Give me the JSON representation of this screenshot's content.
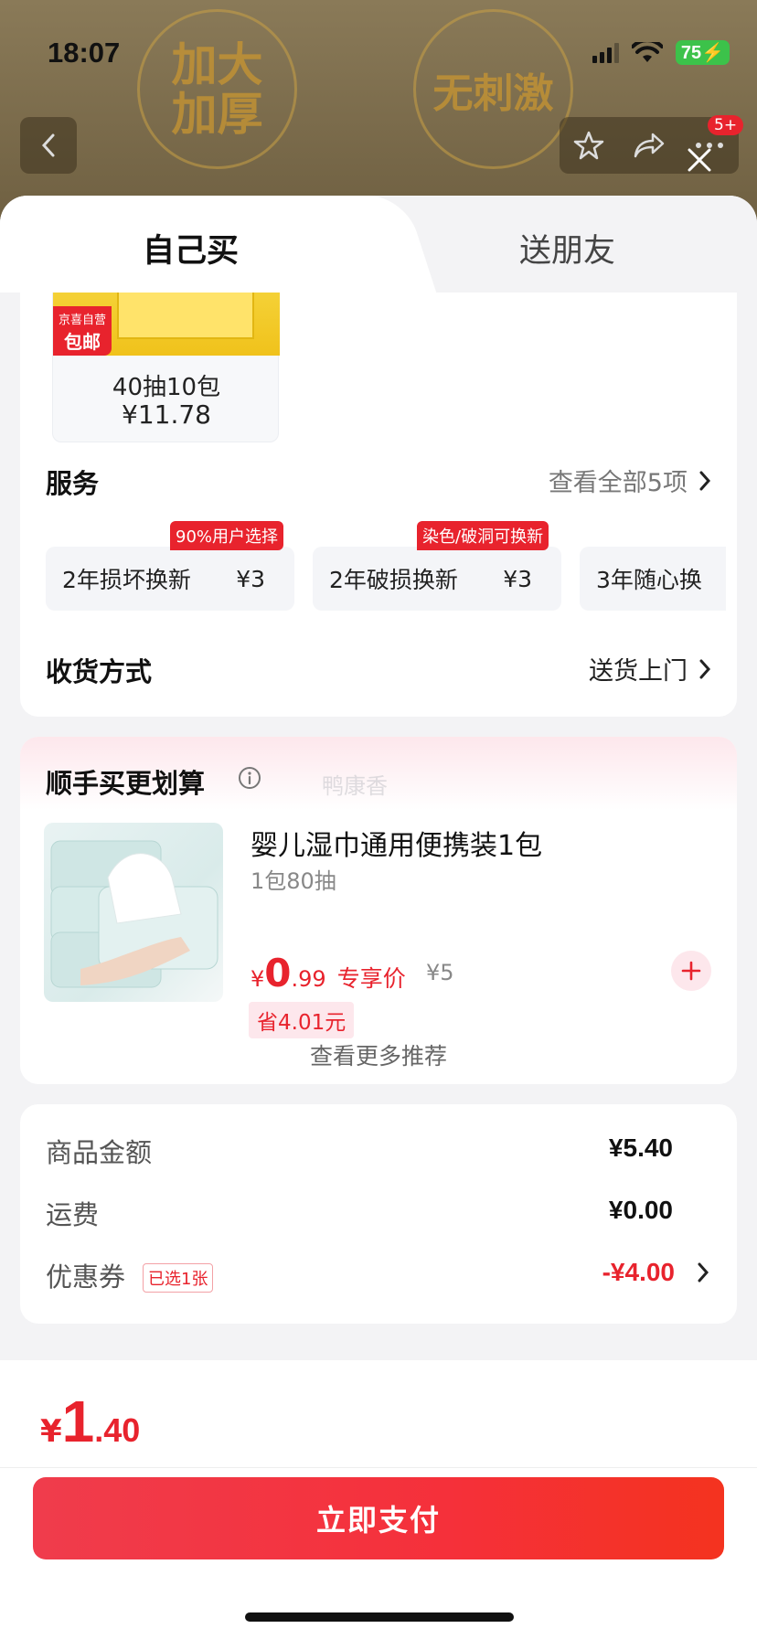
{
  "status": {
    "time": "18:07",
    "battery": "75"
  },
  "background": {
    "circle1": "加大加厚",
    "circle2": "无刺激",
    "cart_badge": "5+"
  },
  "tabs": [
    {
      "label": "自己买"
    },
    {
      "label": "送朋友"
    }
  ],
  "product": {
    "tag_top": "京喜自营",
    "tag_bottom": "包邮",
    "name": "40抽10包",
    "price": "¥11.78"
  },
  "service": {
    "title": "服务",
    "view_all": "查看全部5项",
    "options": [
      {
        "label": "2年损坏换新",
        "price": "¥3",
        "tag": "90%用户选择"
      },
      {
        "label": "2年破损换新",
        "price": "¥3",
        "tag": "染色/破洞可换新"
      },
      {
        "label": "3年随心换",
        "price": "",
        "tag": ""
      }
    ]
  },
  "delivery": {
    "title": "收货方式",
    "value": "送货上门"
  },
  "addon": {
    "title": "顺手买更划算",
    "watermark": "鸭康香",
    "item": {
      "name": "婴儿湿巾通用便携装1包",
      "spec": "1包80抽",
      "price_cur": "¥",
      "price_int": "0",
      "price_dec": ".99",
      "price_label": "专享价",
      "original": "¥5",
      "save": "省4.01元"
    },
    "more": "查看更多推荐"
  },
  "summary": {
    "goods_label": "商品金额",
    "goods_value": "¥5.40",
    "shipping_label": "运费",
    "shipping_value": "¥0.00",
    "coupon_label": "优惠券",
    "coupon_badge": "已选1张",
    "coupon_value": "-¥4.00"
  },
  "footer": {
    "total_cur": "¥",
    "total_int": "1",
    "total_dec": ".40",
    "pay_label": "立即支付"
  },
  "colors": {
    "accent": "#e8232d",
    "battery": "#3cc24a"
  }
}
